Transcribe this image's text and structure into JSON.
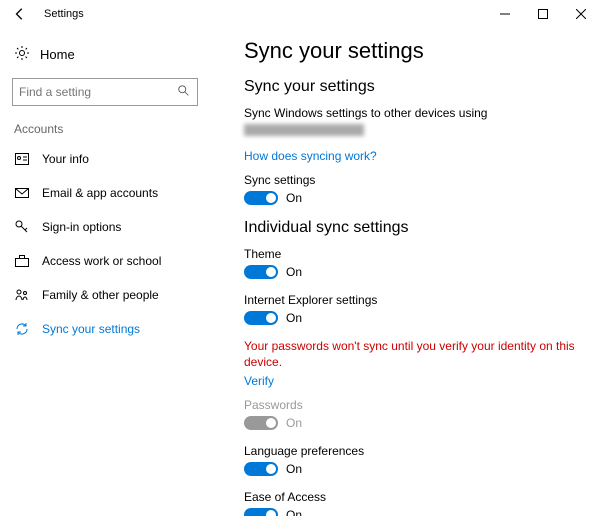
{
  "window": {
    "title": "Settings"
  },
  "sidebar": {
    "home": "Home",
    "search_placeholder": "Find a setting",
    "category": "Accounts",
    "items": [
      {
        "label": "Your info"
      },
      {
        "label": "Email & app accounts"
      },
      {
        "label": "Sign-in options"
      },
      {
        "label": "Access work or school"
      },
      {
        "label": "Family & other people"
      },
      {
        "label": "Sync your settings"
      }
    ]
  },
  "main": {
    "title": "Sync your settings",
    "section1_title": "Sync your settings",
    "desc": "Sync Windows settings to other devices using",
    "how_link": "How does syncing work?",
    "sync_label": "Sync settings",
    "sync_state": "On",
    "section2_title": "Individual sync settings",
    "theme_label": "Theme",
    "theme_state": "On",
    "ie_label": "Internet Explorer settings",
    "ie_state": "On",
    "warn": "Your passwords won't sync until you verify your identity on this device.",
    "verify_link": "Verify",
    "pwd_label": "Passwords",
    "pwd_state": "On",
    "lang_label": "Language preferences",
    "lang_state": "On",
    "ease_label": "Ease of Access",
    "ease_state": "On"
  }
}
